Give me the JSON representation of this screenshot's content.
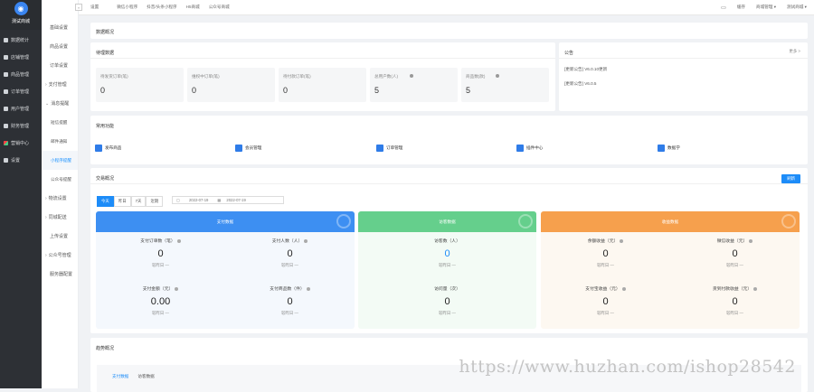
{
  "sidebar": {
    "shop": "测试商城",
    "items": [
      {
        "label": "数据统计",
        "icon": "chart-icon"
      },
      {
        "label": "店铺管理",
        "icon": "store-icon"
      },
      {
        "label": "商品管理",
        "icon": "goods-icon"
      },
      {
        "label": "订单管理",
        "icon": "order-icon"
      },
      {
        "label": "用户管理",
        "icon": "user-icon"
      },
      {
        "label": "财务管理",
        "icon": "finance-icon"
      },
      {
        "label": "营销中心",
        "icon": "marketing-icon"
      },
      {
        "label": "设置",
        "icon": "settings-icon"
      }
    ]
  },
  "submenu": [
    {
      "label": "基础设置",
      "type": "plain"
    },
    {
      "label": "商品设置",
      "type": "plain"
    },
    {
      "label": "订单设置",
      "type": "plain"
    },
    {
      "label": "支付管理",
      "type": "arrow"
    },
    {
      "label": "消息提醒",
      "type": "arrow-open"
    },
    {
      "label": "短信提醒",
      "type": "child"
    },
    {
      "label": "邮件通知",
      "type": "child"
    },
    {
      "label": "小程序提醒",
      "type": "child-active"
    },
    {
      "label": "公众号提醒",
      "type": "child"
    },
    {
      "label": "物流设置",
      "type": "arrow"
    },
    {
      "label": "同城配送",
      "type": "arrow"
    },
    {
      "label": "上传设置",
      "type": "plain"
    },
    {
      "label": "公众号管理",
      "type": "arrow"
    },
    {
      "label": "服务器配置",
      "type": "plain"
    }
  ],
  "topbar": {
    "collapse": "«",
    "first": "设置",
    "nav": [
      "微信小程序",
      "抖音/头条小程序",
      "H5商城",
      "公众号商城"
    ],
    "right": [
      "缓存",
      "商城管理",
      "测试商城"
    ]
  },
  "overview": {
    "title": "数据概况"
  },
  "pending": {
    "title": "待理数据",
    "boxes": [
      {
        "label": "待发货订单(笔)",
        "value": "0"
      },
      {
        "label": "维权中订单(笔)",
        "value": "0"
      },
      {
        "label": "待付款订单(笔)",
        "value": "0"
      },
      {
        "label": "总用户数(人)",
        "value": "5"
      },
      {
        "label": "商品数(款)",
        "value": "5"
      }
    ]
  },
  "notice": {
    "title": "公告",
    "more": "更多 >",
    "items": [
      "[更新公告] V6.0.10更新",
      "[更新公告] V6.0.5"
    ]
  },
  "quick": {
    "title": "常用功能",
    "items": [
      "发布商品",
      "会员管理",
      "订单管理",
      "插件中心",
      "数据学"
    ]
  },
  "trade": {
    "title": "交易概况",
    "refresh": "刷新",
    "tabs": [
      "今天",
      "昨日",
      "7天",
      "近期"
    ],
    "date_from": "2022-07-19",
    "date_to": "2022-07-19",
    "panels": [
      {
        "title": "支付数据",
        "color": "#3d8ff2",
        "bg": "#f4f8fd",
        "metrics": [
          {
            "label": "支付订单数（笔）",
            "value": "0",
            "cmp": "较昨日 —"
          },
          {
            "label": "支付人数（人）",
            "value": "0",
            "cmp": "较昨日 —"
          },
          {
            "label": "支付金额（元）",
            "value": "0.00",
            "cmp": "较昨日 —"
          },
          {
            "label": "支付商品数（件）",
            "value": "0",
            "cmp": "较昨日 —"
          }
        ]
      },
      {
        "title": "访客数据",
        "color": "#65cf8c",
        "bg": "#f3fbf5",
        "metrics": [
          {
            "label": "访客数（人）",
            "value": "0",
            "cmp": "较昨日 —",
            "value_color": "#1d8cf8"
          },
          {
            "label": "访问量（次）",
            "value": "0",
            "cmp": "较昨日 —"
          }
        ]
      },
      {
        "title": "收益数据",
        "color": "#f6a04d",
        "bg": "#fdf8f1",
        "metrics": [
          {
            "label": "余额收益（元）",
            "value": "0",
            "cmp": "较昨日 —"
          },
          {
            "label": "微信收益（元）",
            "value": "0",
            "cmp": "较昨日 —"
          },
          {
            "label": "支付宝收益（元）",
            "value": "0",
            "cmp": "较昨日 —"
          },
          {
            "label": "货到付款收益（元）",
            "value": "0",
            "cmp": "较昨日 —"
          }
        ]
      }
    ]
  },
  "trend": {
    "title": "趋势概况",
    "tabs": [
      "支付数据",
      "访客数据"
    ]
  },
  "watermark": "https://www.huzhan.com/ishop28542"
}
